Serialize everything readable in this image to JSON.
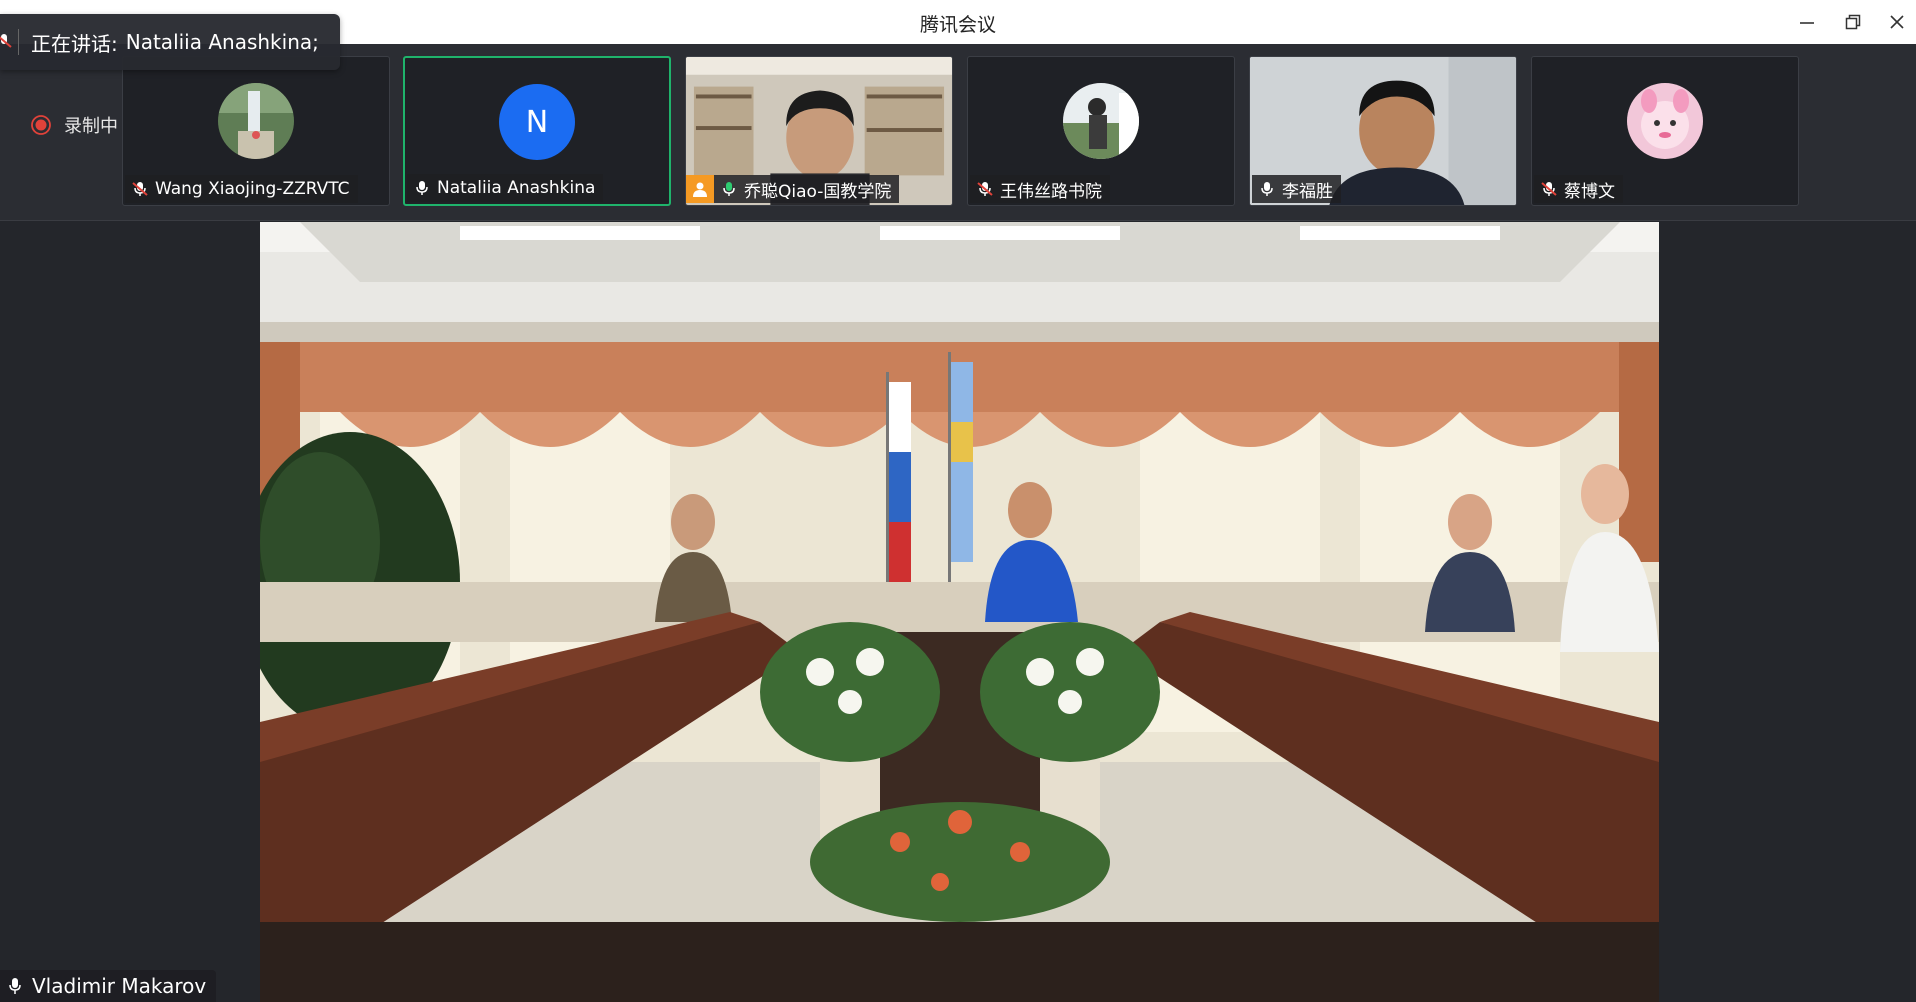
{
  "window": {
    "title": "腾讯会议"
  },
  "speaking": {
    "label": "正在讲话:",
    "name": "Nataliia Anashkina;"
  },
  "recording": {
    "label": "录制中"
  },
  "participants": [
    {
      "name": "Wang Xiaojing-ZZRVTC",
      "mic": "muted"
    },
    {
      "name": "Nataliia Anashkina",
      "mic": "on",
      "initial": "N"
    },
    {
      "name": "乔聪Qiao-国教学院",
      "mic": "speaking"
    },
    {
      "name": "王伟丝路书院",
      "mic": "muted"
    },
    {
      "name": "李福胜",
      "mic": "on"
    },
    {
      "name": "蔡博文",
      "mic": "muted"
    }
  ],
  "main_speaker": {
    "name": "Vladimir Makarov"
  },
  "icons": [
    "minimize-icon",
    "restore-icon",
    "close-icon",
    "mic-icon",
    "mic-muted-icon",
    "record-icon",
    "person-icon"
  ],
  "colors": {
    "active_border": "#1fb36b",
    "avatar_blue": "#1b6cf2",
    "record_red": "#e0423a"
  }
}
